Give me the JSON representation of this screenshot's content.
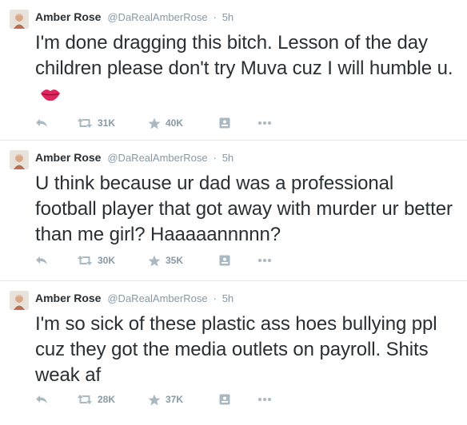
{
  "tweets": [
    {
      "author": {
        "name": "Amber Rose",
        "handle": "@DaRealAmberRose",
        "time": "5h"
      },
      "text": "I'm done dragging this bitch. Lesson of the day children please don't try Muva cuz I will humble u.",
      "emoji": "kiss-mark-icon",
      "retweets": "31K",
      "favorites": "40K"
    },
    {
      "author": {
        "name": "Amber Rose",
        "handle": "@DaRealAmberRose",
        "time": "5h"
      },
      "text": "U think because ur dad was a professional football player that got away with murder ur better than me girl? Haaaaannnnn?",
      "retweets": "30K",
      "favorites": "35K"
    },
    {
      "author": {
        "name": "Amber Rose",
        "handle": "@DaRealAmberRose",
        "time": "5h"
      },
      "text": "I'm so sick of these plastic ass hoes bullying ppl cuz they got the media outlets on payroll. Shits weak af",
      "retweets": "28K",
      "favorites": "37K"
    }
  ],
  "separator": "·",
  "colors": {
    "text": "#292f33",
    "meta": "#8899a6",
    "icon": "#aab8c2",
    "divider": "#e1e8ed",
    "lips": "#e0245e"
  }
}
